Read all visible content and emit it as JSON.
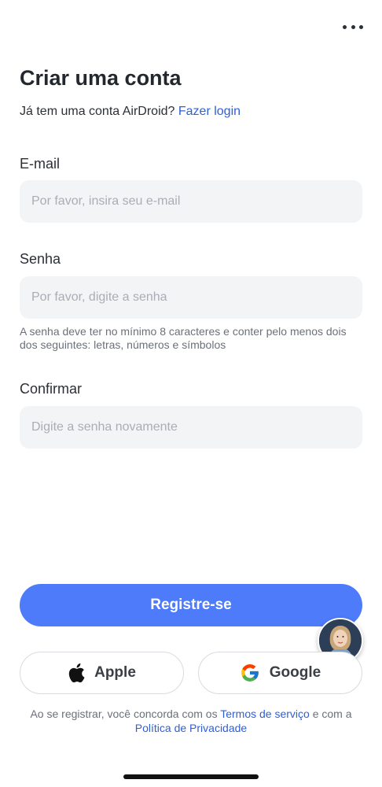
{
  "header": {
    "title": "Criar uma conta",
    "subtitle_text": "Já tem uma conta AirDroid?",
    "login_link": "Fazer login",
    "more_icon": "more-horizontal-icon"
  },
  "form": {
    "email": {
      "label": "E-mail",
      "value": "",
      "placeholder": "Por favor, insira seu e-mail"
    },
    "password": {
      "label": "Senha",
      "value": "",
      "placeholder": "Por favor, digite a senha"
    },
    "password_hint": "A senha deve ter no mínimo 8 caracteres e conter pelo menos dois dos seguintes: letras, números e símbolos",
    "confirm": {
      "label": "Confirmar",
      "value": "",
      "placeholder": "Digite a senha novamente"
    }
  },
  "actions": {
    "register_label": "Registre-se",
    "apple_label": "Apple",
    "google_label": "Google"
  },
  "terms": {
    "prefix": "Ao se registrar, você concorda com os",
    "terms_link": "Termos de serviço",
    "middle": "e com a",
    "privacy_link": "Política de Privacidade"
  },
  "colors": {
    "accent": "#4e7bfa",
    "link": "#2f5fd6",
    "field_bg": "#f3f4f6"
  }
}
